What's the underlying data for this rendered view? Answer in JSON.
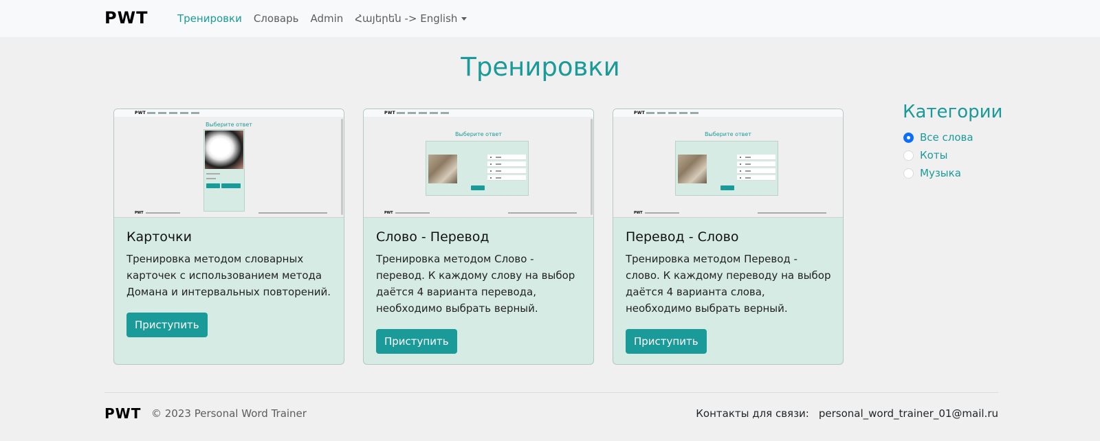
{
  "navbar": {
    "brand": "PWT",
    "links": [
      {
        "label": "Тренировки",
        "active": true
      },
      {
        "label": "Словарь",
        "active": false
      },
      {
        "label": "Admin",
        "active": false
      }
    ],
    "language_dropdown": "Հայերեն -> English"
  },
  "page": {
    "title": "Тренировки"
  },
  "cards": [
    {
      "title": "Карточки",
      "text": "Тренировка методом словарных карточек с использованием метода Домана и интервальных повторений.",
      "button": "Приступить",
      "thumb_title": "Выберите ответ"
    },
    {
      "title": "Слово - Перевод",
      "text": "Тренировка методом Слово - перевод. К каждому слову на выбор даётся 4 варианта перевода, необходимо выбрать верный.",
      "button": "Приступить",
      "thumb_title": "Выберите ответ"
    },
    {
      "title": "Перевод - Слово",
      "text": "Тренировка методом Перевод - слово. К каждому переводу на выбор даётся 4 варианта слова, необходимо выбрать верный.",
      "button": "Приступить",
      "thumb_title": "Выберите ответ"
    }
  ],
  "categories": {
    "title": "Категории",
    "items": [
      {
        "label": "Все слова",
        "checked": true
      },
      {
        "label": "Коты",
        "checked": false
      },
      {
        "label": "Музыка",
        "checked": false
      }
    ]
  },
  "footer": {
    "brand": "PWT",
    "copyright": "© 2023 Personal Word Trainer",
    "contacts_label": "Контакты для связи:",
    "email": "personal_word_trainer_01@mail.ru"
  },
  "colors": {
    "accent": "#1a9a98",
    "card_bg": "#d5ebe4",
    "page_bg": "#f0f0f0",
    "radio_checked": "#0d6efd"
  }
}
